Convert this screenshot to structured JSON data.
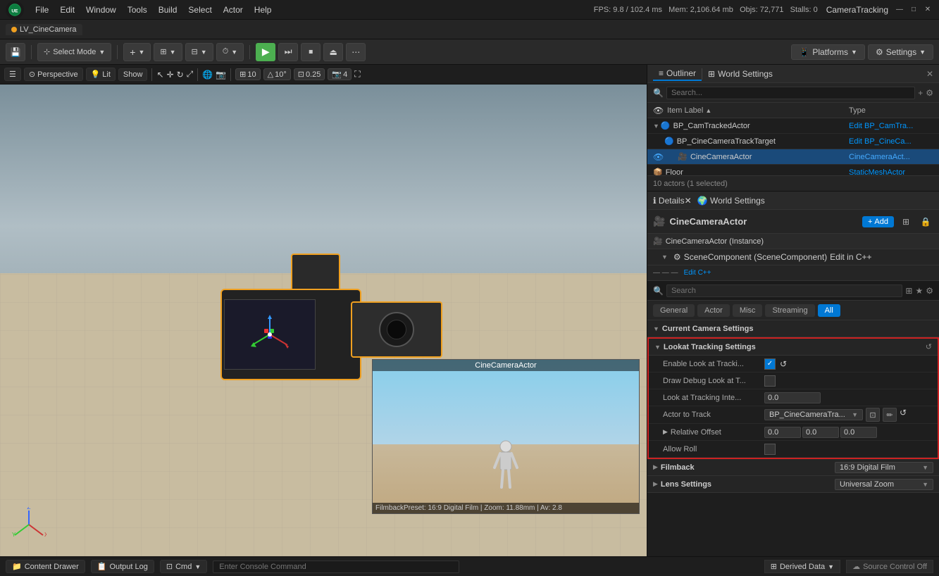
{
  "app": {
    "logo": "UE",
    "window_title": "CameraTracking",
    "fps": "FPS: 9.8 / 102.4 ms",
    "mem": "Mem: 2,106.64 mb",
    "objs": "Objs: 72,771",
    "stalls": "Stalls: 0"
  },
  "menu": {
    "items": [
      "File",
      "Edit",
      "Window",
      "Tools",
      "Build",
      "Select",
      "Actor",
      "Help"
    ]
  },
  "tab": {
    "label": "LV_CineCamera"
  },
  "toolbar": {
    "save_label": "💾",
    "select_mode": "Select Mode",
    "add_dropdown": "+",
    "grid_dropdown": "⊞",
    "snap_dropdown": "⊟",
    "play": "▶",
    "step": "⏭",
    "stop": "⏹",
    "eject": "⏏",
    "more": "⋯",
    "platforms": "Platforms",
    "settings": "Settings"
  },
  "viewport": {
    "perspective": "Perspective",
    "lit": "Lit",
    "show": "Show",
    "grid_size": "10",
    "angle": "10°",
    "scale": "0.25",
    "cam_speed": "4",
    "preview_title": "CineCameraActor",
    "preview_footer": "FilmbackPreset: 16:9 Digital Film | Zoom: 11.88mm | Av: 2.8"
  },
  "outliner": {
    "title": "Outliner",
    "search_placeholder": "Search...",
    "col_label": "Item Label",
    "col_type": "Type",
    "actors_info": "10 actors (1 selected)",
    "rows": [
      {
        "indent": 0,
        "has_arrow": true,
        "arrow": "▼",
        "icon": "🔵",
        "label": "BP_CamTrackedActor",
        "type": "Edit BP_CamTra...",
        "selected": false
      },
      {
        "indent": 1,
        "has_arrow": false,
        "arrow": "",
        "icon": "🔵",
        "label": "BP_CineCameraTrackTarget",
        "type": "Edit BP_CineCa...",
        "selected": false
      },
      {
        "indent": 1,
        "has_arrow": false,
        "arrow": "",
        "icon": "🎥",
        "label": "CineCameraActor",
        "type": "CineCameraAct...",
        "selected": true
      },
      {
        "indent": 0,
        "has_arrow": false,
        "arrow": "",
        "icon": "📦",
        "label": "Floor",
        "type": "StaticMeshActor",
        "selected": false
      }
    ]
  },
  "details": {
    "title": "Details",
    "world_settings": "World Settings",
    "actor_name": "CineCameraActor",
    "component_instance": "CineCameraActor (Instance)",
    "component_scene": "SceneComponent (SceneComponent)",
    "component_link": "Edit in C++",
    "search_placeholder": "Search",
    "tabs": [
      "General",
      "Actor",
      "Misc",
      "Streaming",
      "All"
    ],
    "active_tab": "All",
    "sections": {
      "current_camera": "Current Camera Settings",
      "lookat": "Lookat Tracking Settings",
      "filmback": "Filmback",
      "lens": "Lens Settings"
    },
    "lookat": {
      "enable_label": "Enable Look at Tracki...",
      "enable_checked": true,
      "debug_label": "Draw Debug Look at T...",
      "debug_checked": false,
      "interp_label": "Look at Tracking Inte...",
      "interp_value": "0.0",
      "actor_track_label": "Actor to Track",
      "actor_track_value": "BP_CineCameraTra...",
      "offset_label": "Relative Offset",
      "offset_x": "0.0",
      "offset_y": "0.0",
      "offset_z": "0.0",
      "roll_label": "Allow Roll",
      "roll_checked": false
    },
    "filmback": {
      "value": "16:9 Digital Film"
    },
    "lens": {
      "value": "Universal Zoom"
    }
  },
  "bottombar": {
    "content_drawer": "Content Drawer",
    "output_log": "Output Log",
    "cmd": "Cmd",
    "console_placeholder": "Enter Console Command",
    "derived_data": "Derived Data",
    "source_control": "Source Control Off"
  }
}
